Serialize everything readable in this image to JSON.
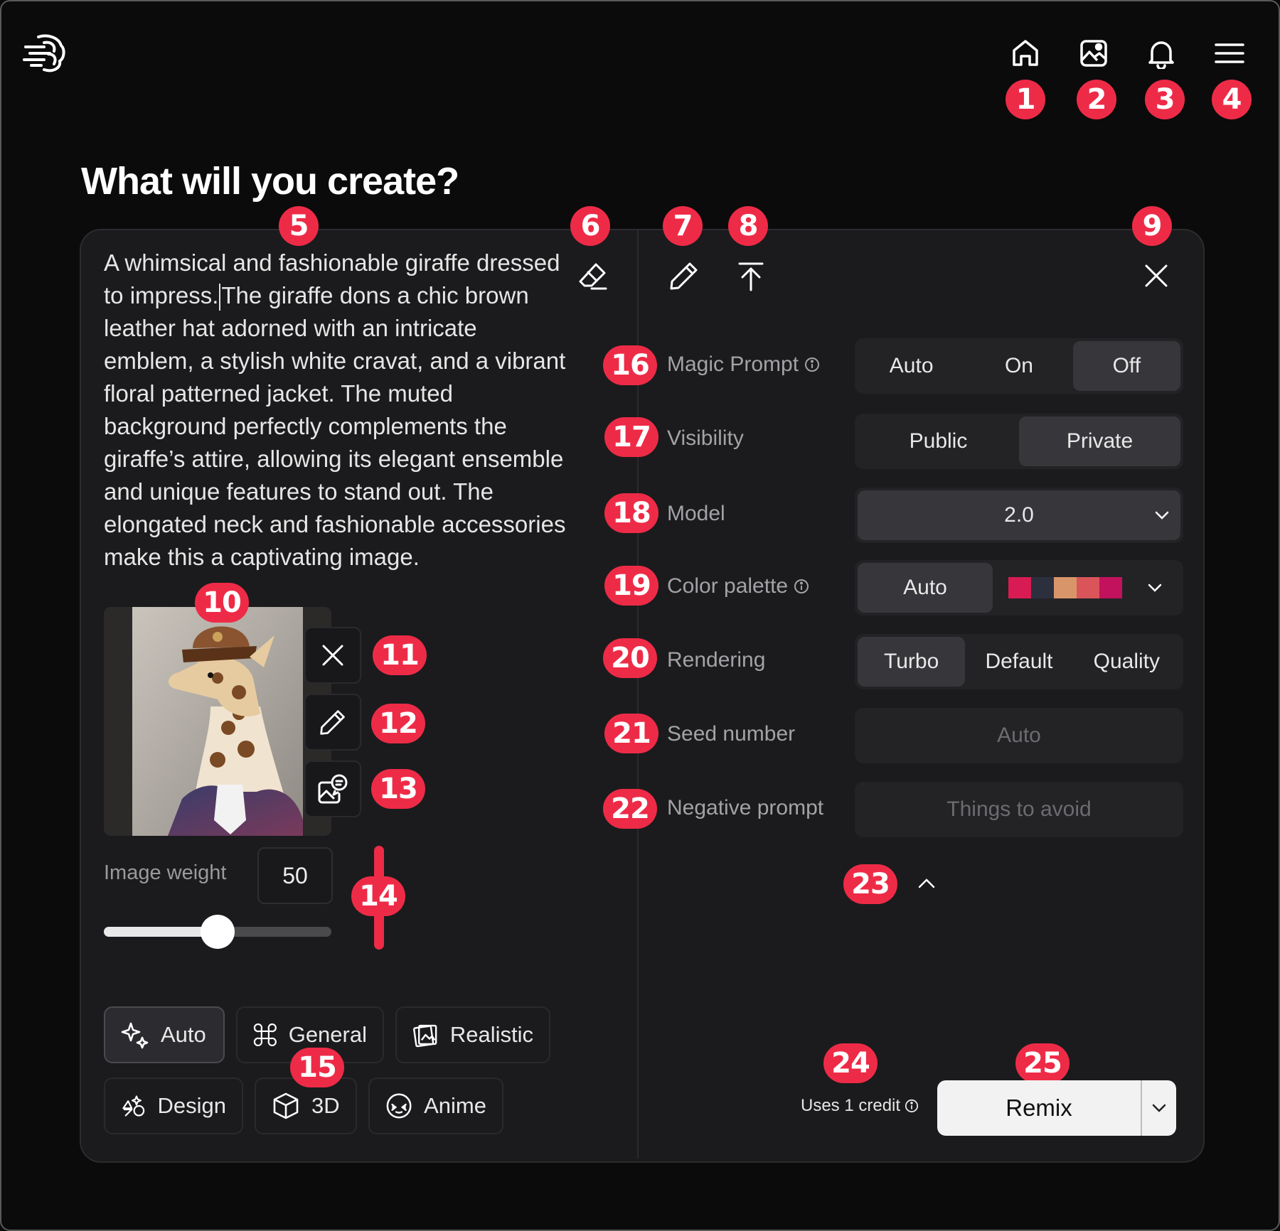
{
  "header": {
    "logo_icon": "brain-logo-icon",
    "nav_icons": [
      "home-icon",
      "gallery-icon",
      "bell-icon",
      "menu-icon"
    ]
  },
  "title": "What will you create?",
  "prompt": {
    "before_caret": "A whimsical and fashionable giraffe dressed to impress.",
    "after_caret": "The giraffe dons a chic brown leather hat adorned with an intricate emblem, a stylish white cravat, and a vibrant floral patterned jacket. The muted background perfectly complements the giraffe’s attire, allowing its elegant ensemble and unique features to stand out. The elongated neck and fashionable accessories make this a captivating image."
  },
  "image_weight": {
    "label": "Image weight",
    "value": "50",
    "fraction": 0.5
  },
  "styles": [
    {
      "label": "Auto",
      "icon": "sparkle-icon",
      "active": true
    },
    {
      "label": "General",
      "icon": "command-icon",
      "active": false
    },
    {
      "label": "Realistic",
      "icon": "photo-stack-icon",
      "active": false
    },
    {
      "label": "Design",
      "icon": "design-shapes-icon",
      "active": false
    },
    {
      "label": "3D",
      "icon": "cube-icon",
      "active": false
    },
    {
      "label": "Anime",
      "icon": "anime-face-icon",
      "active": false
    }
  ],
  "settings": {
    "magic_prompt": {
      "label": "Magic Prompt",
      "options": [
        "Auto",
        "On",
        "Off"
      ],
      "selected": "Off"
    },
    "visibility": {
      "label": "Visibility",
      "options": [
        "Public",
        "Private"
      ],
      "selected": "Private"
    },
    "model": {
      "label": "Model",
      "value": "2.0"
    },
    "color_palette": {
      "label": "Color palette",
      "value": "Auto",
      "swatches": [
        "#d81b52",
        "#2c2f3e",
        "#d9956a",
        "#d9555a",
        "#c2125e"
      ]
    },
    "rendering": {
      "label": "Rendering",
      "options": [
        "Turbo",
        "Default",
        "Quality"
      ],
      "selected": "Turbo"
    },
    "seed": {
      "label": "Seed number",
      "placeholder": "Auto"
    },
    "negative": {
      "label": "Negative prompt",
      "placeholder": "Things to avoid"
    }
  },
  "footer": {
    "credit": "Uses 1 credit",
    "action": "Remix"
  },
  "badges": [
    "1",
    "2",
    "3",
    "4",
    "5",
    "6",
    "7",
    "8",
    "9",
    "10",
    "11",
    "12",
    "13",
    "14",
    "15",
    "16",
    "17",
    "18",
    "19",
    "20",
    "21",
    "22",
    "23",
    "24",
    "25"
  ],
  "colors": {
    "badge": "#ee2b47",
    "panel": "#1b1b1d",
    "background": "#0b0b0b"
  }
}
